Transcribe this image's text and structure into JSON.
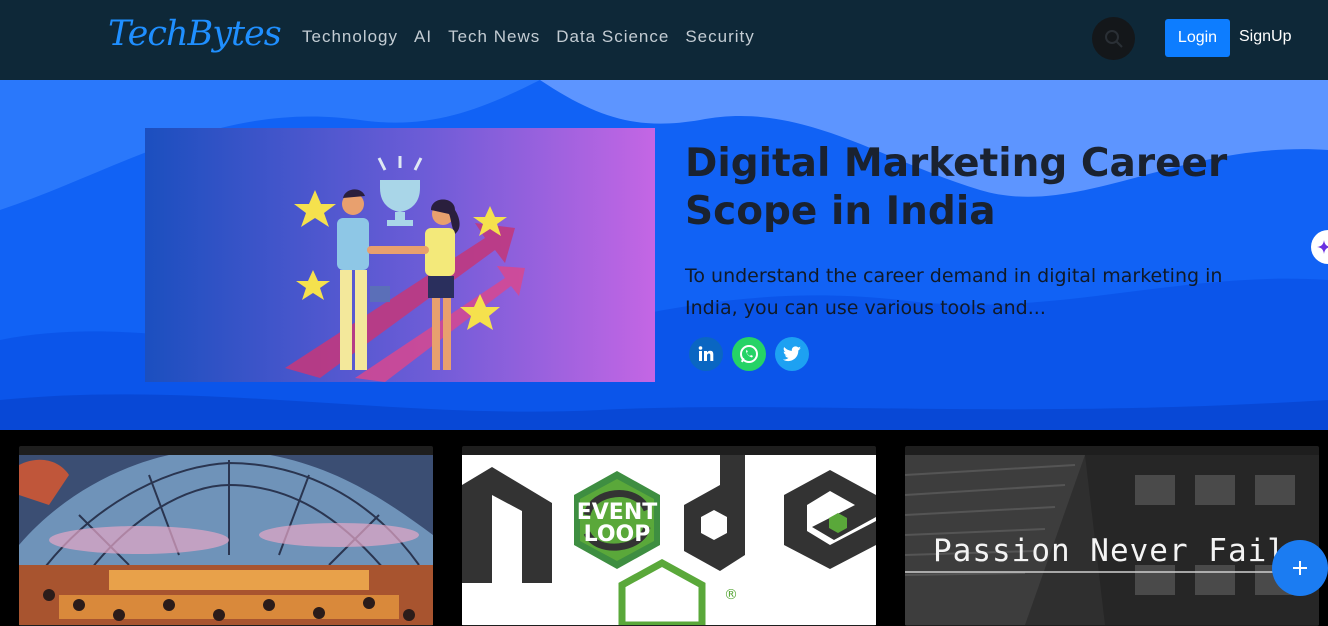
{
  "brand": {
    "logo_text": "TechBytes"
  },
  "nav": {
    "links": [
      "Technology",
      "AI",
      "Tech News",
      "Data Science",
      "Security"
    ],
    "login_label": "Login",
    "signup_label": "SignUp"
  },
  "hero": {
    "title": "Digital Marketing Career Scope in India",
    "excerpt": "To understand the career demand in digital marketing in India, you can use various tools and...",
    "share": [
      "linkedin-icon",
      "whatsapp-icon",
      "twitter-icon"
    ]
  },
  "cards": {
    "card2_badge_line1": "EVENT",
    "card2_badge_line2": "LOOP",
    "card3_caption": "Passion Never Fail"
  },
  "colors": {
    "navbar": "#0e2838",
    "accent": "#0d7dff",
    "hero_bg": "#1162f5",
    "logo": "#1f8fff"
  }
}
